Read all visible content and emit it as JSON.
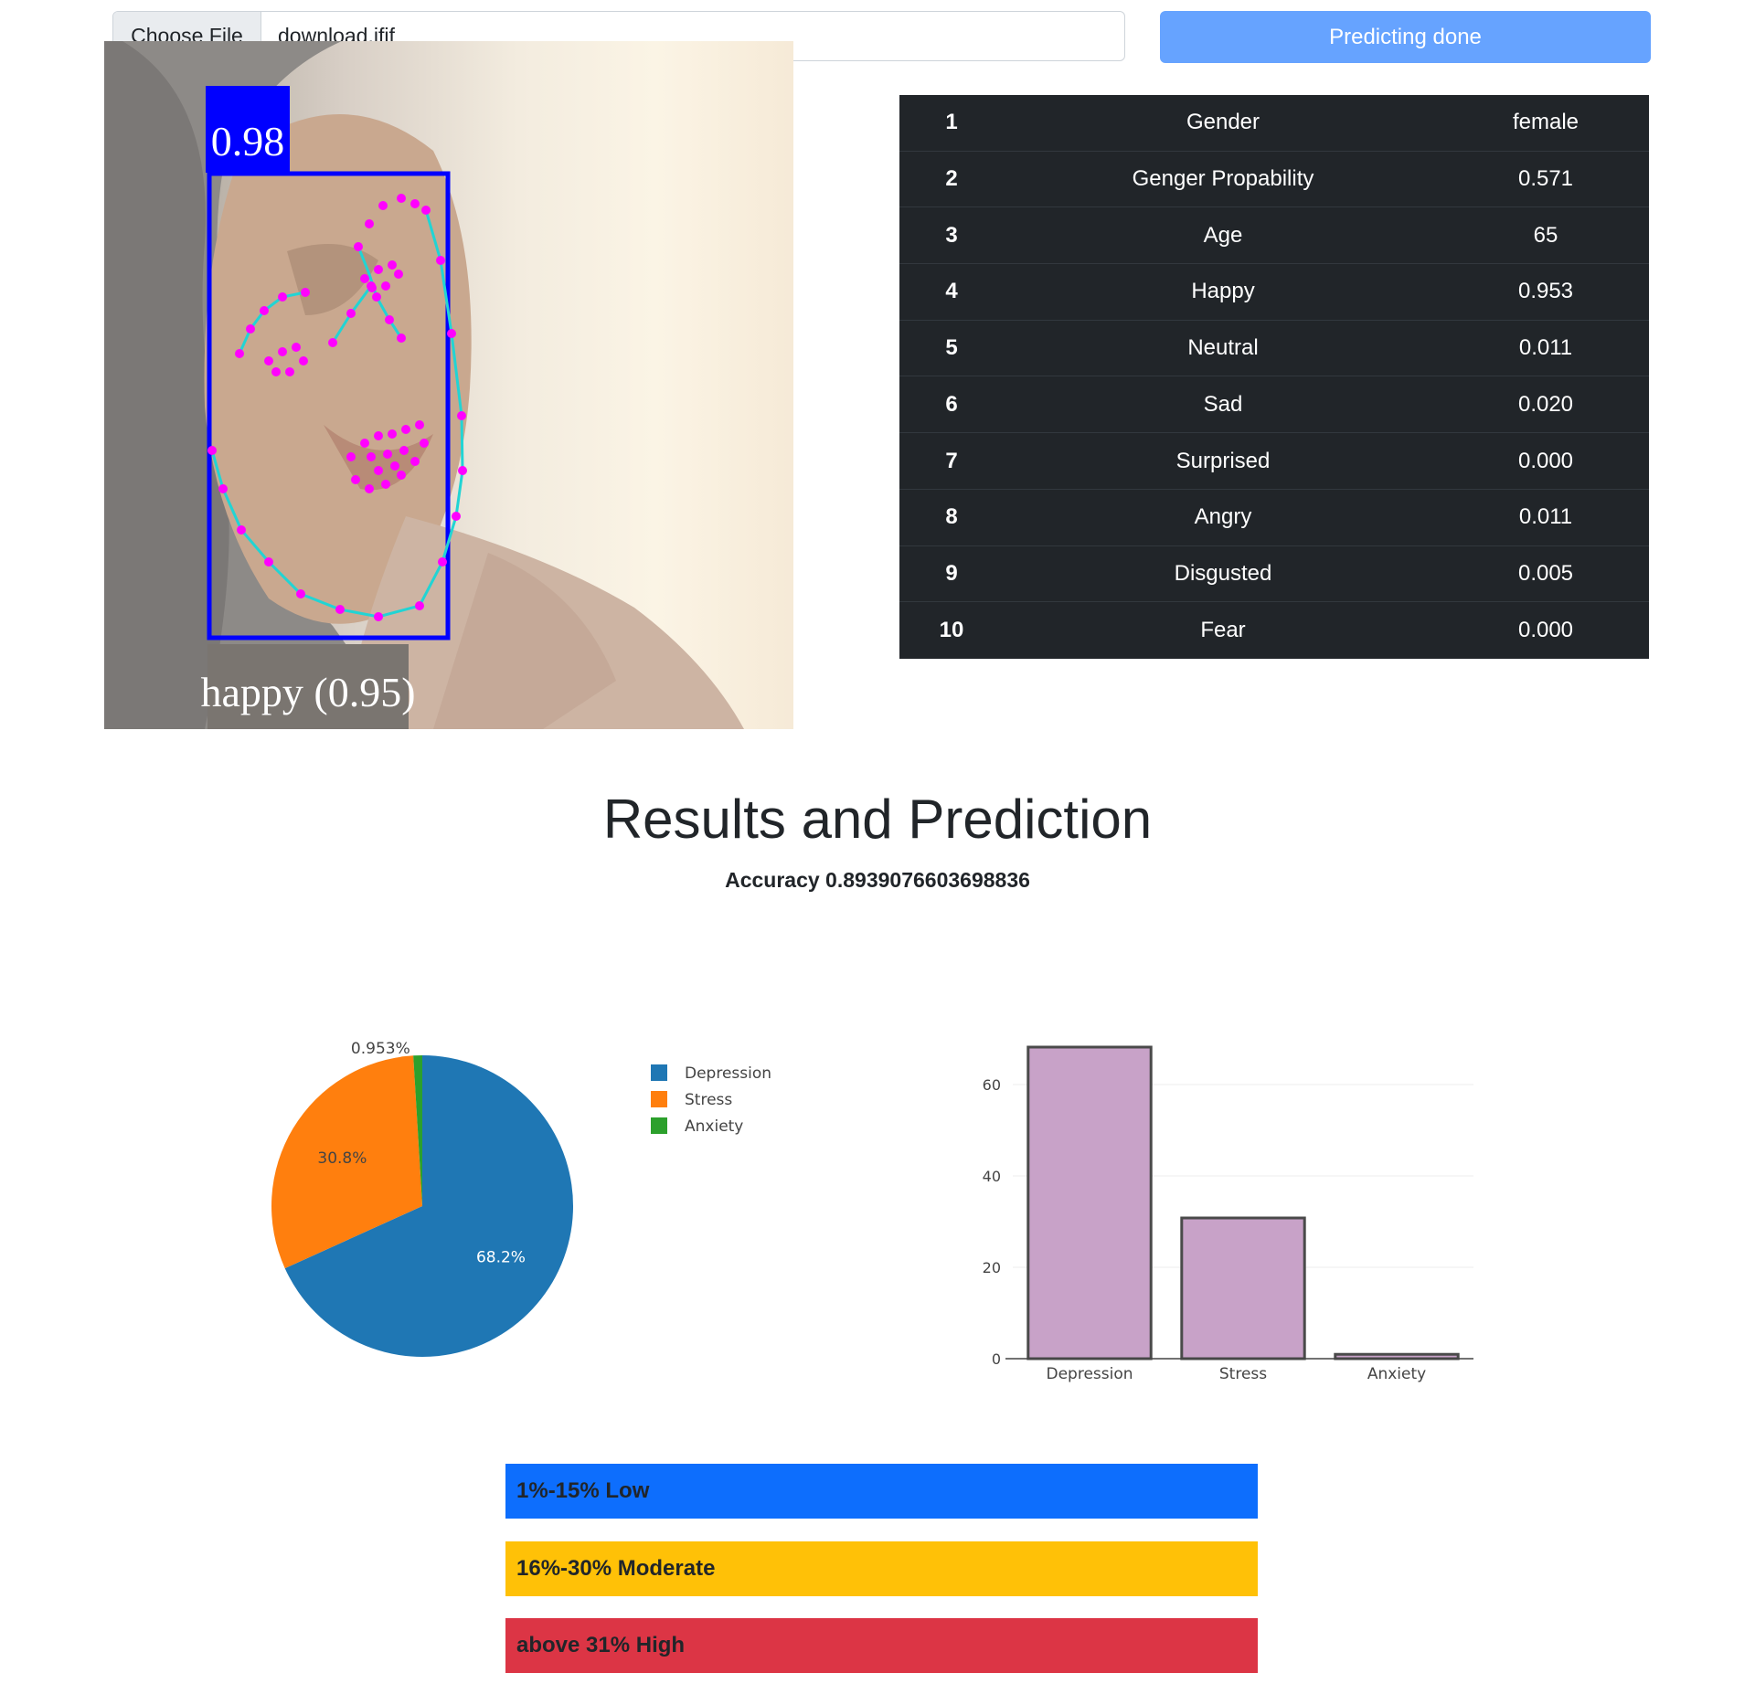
{
  "upload": {
    "choose_label": "Choose File",
    "file_name": "download.jfif",
    "predict_label": "Predicting done"
  },
  "image": {
    "face_score": "0.98",
    "emotion_caption": "happy (0.95)"
  },
  "table": {
    "rows": [
      {
        "num": "1",
        "label": "Gender",
        "value": "female"
      },
      {
        "num": "2",
        "label": "Genger Propability",
        "value": "0.571"
      },
      {
        "num": "3",
        "label": "Age",
        "value": "65"
      },
      {
        "num": "4",
        "label": "Happy",
        "value": "0.953"
      },
      {
        "num": "5",
        "label": "Neutral",
        "value": "0.011"
      },
      {
        "num": "6",
        "label": "Sad",
        "value": "0.020"
      },
      {
        "num": "7",
        "label": "Surprised",
        "value": "0.000"
      },
      {
        "num": "8",
        "label": "Angry",
        "value": "0.011"
      },
      {
        "num": "9",
        "label": "Disgusted",
        "value": "0.005"
      },
      {
        "num": "10",
        "label": "Fear",
        "value": "0.000"
      }
    ]
  },
  "results": {
    "title": "Results and Prediction",
    "accuracy": "Accuracy 0.8939076603698836"
  },
  "chart_data": [
    {
      "type": "pie",
      "labels": [
        "Depression",
        "Stress",
        "Anxiety"
      ],
      "values": [
        68.2,
        30.8,
        0.953
      ],
      "slice_labels": [
        "68.2%",
        "30.8%",
        "0.953%"
      ],
      "colors": [
        "#1f77b4",
        "#ff7f0e",
        "#2ca02c"
      ],
      "legend": "right"
    },
    {
      "type": "bar",
      "categories": [
        "Depression",
        "Stress",
        "Anxiety"
      ],
      "values": [
        68.2,
        30.8,
        0.953
      ],
      "ylim": [
        0,
        70
      ],
      "yticks": [
        "0",
        "20",
        "40",
        "60"
      ],
      "bar_color": "#c8a2c8",
      "bar_edge": "#4a4a4a",
      "grid": true
    }
  ],
  "levels": [
    {
      "label": "1%-15% Low",
      "color": "#0d6efd"
    },
    {
      "label": "16%-30% Moderate",
      "color": "#ffc107"
    },
    {
      "label": "above 31% High",
      "color": "#dc3545"
    }
  ]
}
